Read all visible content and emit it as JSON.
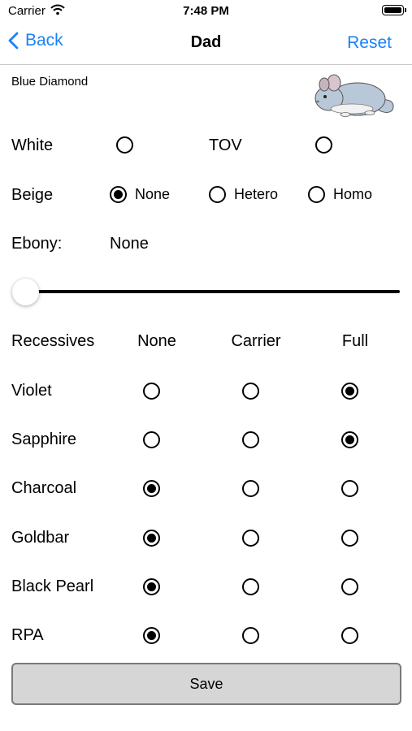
{
  "status": {
    "carrier": "Carrier",
    "time": "7:48 PM"
  },
  "nav": {
    "back": "Back",
    "title": "Dad",
    "reset": "Reset"
  },
  "subtitle": "Blue Diamond",
  "white": {
    "label": "White",
    "tov_label": "TOV",
    "white_selected": false,
    "tov_selected": false
  },
  "beige": {
    "label": "Beige",
    "options": [
      "None",
      "Hetero",
      "Homo"
    ],
    "selected": "None"
  },
  "ebony": {
    "label": "Ebony:",
    "value": "None",
    "slider_level": 0
  },
  "recessives": {
    "label": "Recessives",
    "columns": [
      "None",
      "Carrier",
      "Full"
    ],
    "rows": [
      {
        "label": "Violet",
        "selected": "Full"
      },
      {
        "label": "Sapphire",
        "selected": "Full"
      },
      {
        "label": "Charcoal",
        "selected": "None"
      },
      {
        "label": "Goldbar",
        "selected": "None"
      },
      {
        "label": "Black Pearl",
        "selected": "None"
      },
      {
        "label": "RPA",
        "selected": "None"
      }
    ]
  },
  "save_label": "Save",
  "colors": {
    "accent": "#1a82f7",
    "button_bg": "#d6d6d6",
    "button_border": "#7a7a7a"
  },
  "icons": {
    "back": "chevron-left-icon",
    "wifi": "wifi-icon",
    "battery": "battery-icon",
    "animal": "chinchilla-image"
  }
}
